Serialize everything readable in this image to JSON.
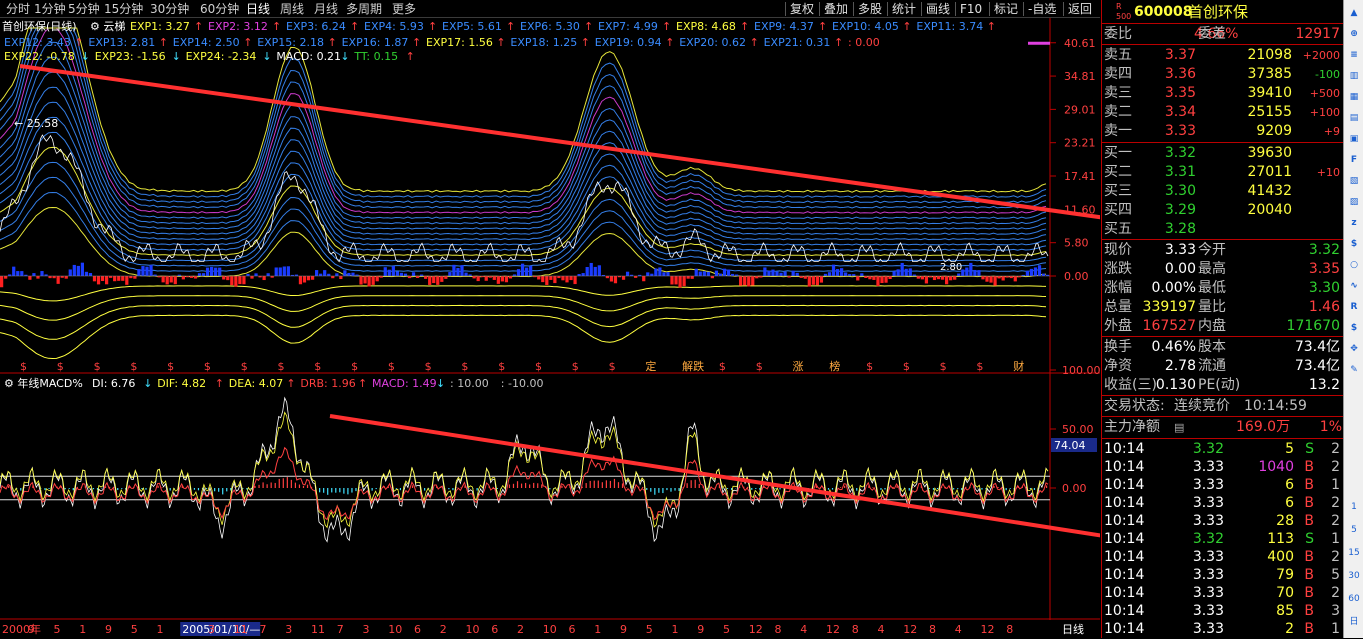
{
  "toolbar": {
    "periods": [
      "分时",
      "1分钟",
      "5分钟",
      "15分钟",
      "30分钟",
      "60分钟",
      "日线",
      "周线",
      "月线",
      "多周期",
      "更多"
    ],
    "selected": "日线",
    "right": [
      "复权",
      "叠加",
      "多股",
      "统计",
      "画线",
      "F10",
      "标记",
      "-自选",
      "返回"
    ]
  },
  "main_chart": {
    "title": "首创环保(日线)",
    "indicator_name": "云梯",
    "exp_items": [
      {
        "label": "EXP1: 3.27",
        "color": "#ffff40",
        "arrow": "↑",
        "arrow_color": "#ff4040"
      },
      {
        "label": "EXP2: 3.12",
        "color": "#e040e0",
        "arrow": "↑",
        "arrow_color": "#ff4040"
      },
      {
        "label": "EXP3: 6.24",
        "color": "#3a8cff",
        "arrow": "↑",
        "arrow_color": "#ff4040"
      },
      {
        "label": "EXP4: 5.93",
        "color": "#3a8cff",
        "arrow": "↑",
        "arrow_color": "#ff4040"
      },
      {
        "label": "EXP5: 5.61",
        "color": "#3a8cff",
        "arrow": "↑",
        "arrow_color": "#ff4040"
      },
      {
        "label": "EXP6: 5.30",
        "color": "#3a8cff",
        "arrow": "↑",
        "arrow_color": "#ff4040"
      },
      {
        "label": "EXP7: 4.99",
        "color": "#3a8cff",
        "arrow": "↑",
        "arrow_color": "#ff4040"
      },
      {
        "label": "EXP8: 4.68",
        "color": "#ffff40",
        "arrow": "↑",
        "arrow_color": "#ff4040"
      },
      {
        "label": "EXP9: 4.37",
        "color": "#3a8cff",
        "arrow": "↑",
        "arrow_color": "#ff4040"
      },
      {
        "label": "EXP10: 4.05",
        "color": "#3a8cff",
        "arrow": "↑",
        "arrow_color": "#ff4040"
      },
      {
        "label": "EXP11: 3.74",
        "color": "#3a8cff",
        "arrow": "↑",
        "arrow_color": "#ff4040"
      },
      {
        "label": "EXP12: 3.43",
        "color": "#3a8cff",
        "arrow": "↑",
        "arrow_color": "#ff4040"
      },
      {
        "label": "EXP13: 2.81",
        "color": "#3a8cff",
        "arrow": "↑",
        "arrow_color": "#ff4040"
      },
      {
        "label": "EXP14: 2.50",
        "color": "#3a8cff",
        "arrow": "↑",
        "arrow_color": "#ff4040"
      },
      {
        "label": "EXP15: 2.18",
        "color": "#3a8cff",
        "arrow": "↑",
        "arrow_color": "#ff4040"
      },
      {
        "label": "EXP16: 1.87",
        "color": "#3a8cff",
        "arrow": "↑",
        "arrow_color": "#ff4040"
      },
      {
        "label": "EXP17: 1.56",
        "color": "#ffff40",
        "arrow": "↑",
        "arrow_color": "#ff4040"
      },
      {
        "label": "EXP18: 1.25",
        "color": "#3a8cff",
        "arrow": "↑",
        "arrow_color": "#ff4040"
      },
      {
        "label": "EXP19: 0.94",
        "color": "#3a8cff",
        "arrow": "↑",
        "arrow_color": "#ff4040"
      },
      {
        "label": "EXP20: 0.62",
        "color": "#3a8cff",
        "arrow": "↑",
        "arrow_color": "#ff4040"
      },
      {
        "label": "EXP21: 0.31",
        "color": "#3a8cff",
        "arrow": "↑",
        "arrow_color": "#ff4040"
      },
      {
        "label": ": 0.00",
        "color": "#ff4040",
        "arrow": "",
        "arrow_color": "#ff4040"
      },
      {
        "label": "EXP22: -0.78",
        "color": "#ffff40",
        "arrow": "↓",
        "arrow_color": "#40e0ff"
      },
      {
        "label": "EXP23: -1.56",
        "color": "#ffff40",
        "arrow": "↓",
        "arrow_color": "#40e0ff"
      },
      {
        "label": "EXP24: -2.34",
        "color": "#ffff40",
        "arrow": "↓",
        "arrow_color": "#40e0ff"
      },
      {
        "label": "MACD: 0.21",
        "color": "#ffffff",
        "arrow": "↓",
        "arrow_color": "#40e0ff"
      },
      {
        "label": "TT: 0.15",
        "color": "#30d030",
        "arrow": "↑",
        "arrow_color": "#ff4040"
      }
    ],
    "y_ticks": [
      "40.61",
      "34.81",
      "29.01",
      "23.21",
      "17.41",
      "11.60",
      "5.80",
      "0.00"
    ],
    "peak_label": "25.58",
    "low_label": "2.80",
    "event_marks": [
      "$",
      "$",
      "$",
      "$",
      "$",
      "$",
      "$",
      "$",
      "$",
      "$",
      "$",
      "$",
      "$",
      "$",
      "$",
      "$",
      "$",
      "定",
      "解跌",
      "$",
      "$",
      "涨",
      "榜",
      "$",
      "$",
      "$",
      "$",
      "财"
    ]
  },
  "sub_chart": {
    "title": "年线MACD%",
    "items": [
      {
        "label": "DI: 6.76",
        "color": "#ffffff",
        "arrow": "↓",
        "arrow_color": "#40e0ff"
      },
      {
        "label": "DIF: 4.82",
        "color": "#ffff40",
        "arrow": "↑",
        "arrow_color": "#ff4040"
      },
      {
        "label": "DEA: 4.07",
        "color": "#ffff40",
        "arrow": "↑",
        "arrow_color": "#ff4040"
      },
      {
        "label": "DRB: 1.96",
        "color": "#ff4040",
        "arrow": "↑",
        "arrow_color": "#ff4040"
      },
      {
        "label": "MACD: 1.49",
        "color": "#e040e0",
        "arrow": "↓",
        "arrow_color": "#40e0ff"
      },
      {
        "label": ": 10.00",
        "color": "#c0c0c0",
        "arrow": "",
        "arrow_color": "#c0c0c0"
      },
      {
        "label": ": -10.00",
        "color": "#c0c0c0",
        "arrow": "",
        "arrow_color": "#c0c0c0"
      }
    ],
    "y_ticks": [
      "100.00",
      "50.00",
      "0.00"
    ],
    "current_value": "74.04"
  },
  "x_axis": {
    "labels": [
      "2000年",
      "9",
      "5",
      "1",
      "9",
      "5",
      "1",
      "2005/01/10/—",
      "3",
      "11",
      "7",
      "3",
      "11",
      "7",
      "3",
      "10",
      "6",
      "2",
      "10",
      "6",
      "2",
      "10",
      "6",
      "1",
      "9",
      "5",
      "1",
      "9",
      "5",
      "12",
      "8",
      "4",
      "12",
      "8",
      "4",
      "12",
      "8",
      "4",
      "12",
      "8"
    ],
    "period": "日线"
  },
  "quote": {
    "code": "600008",
    "name": "首创环保",
    "commission_ratio_label": "委比",
    "commission_ratio": "4.66%",
    "commission_diff_label": "委差",
    "commission_diff": "12917",
    "asks": [
      {
        "label": "卖五",
        "price": "3.37",
        "vol": "21098",
        "chg": "+2000"
      },
      {
        "label": "卖四",
        "price": "3.36",
        "vol": "37385",
        "chg": "-100"
      },
      {
        "label": "卖三",
        "price": "3.35",
        "vol": "39410",
        "chg": "+500"
      },
      {
        "label": "卖二",
        "price": "3.34",
        "vol": "25155",
        "chg": "+100"
      },
      {
        "label": "卖一",
        "price": "3.33",
        "vol": "9209",
        "chg": "+9"
      }
    ],
    "bids": [
      {
        "label": "买一",
        "price": "3.32",
        "vol": "39630",
        "chg": ""
      },
      {
        "label": "买二",
        "price": "3.31",
        "vol": "27011",
        "chg": "+10"
      },
      {
        "label": "买三",
        "price": "3.30",
        "vol": "41432",
        "chg": ""
      },
      {
        "label": "买四",
        "price": "3.29",
        "vol": "20040",
        "chg": ""
      },
      {
        "label": "买五",
        "price": "3.28",
        "vol": "",
        "chg": ""
      }
    ],
    "stats": [
      {
        "l1": "现价",
        "v1": "3.33",
        "c1": "wht",
        "l2": "今开",
        "v2": "3.32",
        "c2": "grn"
      },
      {
        "l1": "涨跌",
        "v1": "0.00",
        "c1": "wht",
        "l2": "最高",
        "v2": "3.35",
        "c2": "red"
      },
      {
        "l1": "涨幅",
        "v1": "0.00%",
        "c1": "wht",
        "l2": "最低",
        "v2": "3.30",
        "c2": "grn"
      },
      {
        "l1": "总量",
        "v1": "339197",
        "c1": "yel",
        "l2": "量比",
        "v2": "1.46",
        "c2": "red"
      },
      {
        "l1": "外盘",
        "v1": "167527",
        "c1": "red",
        "l2": "内盘",
        "v2": "171670",
        "c2": "grn"
      }
    ],
    "stats2": [
      {
        "l1": "换手",
        "v1": "0.46%",
        "l2": "股本",
        "v2": "73.4亿"
      },
      {
        "l1": "净资",
        "v1": "2.78",
        "l2": "流通",
        "v2": "73.4亿"
      },
      {
        "l1": "收益(三)",
        "v1": "0.130",
        "l2": "PE(动)",
        "v2": "13.2"
      }
    ],
    "trade_status_label": "交易状态:",
    "trade_status": "连续竞价",
    "trade_time": "10:14:59",
    "main_net_label": "主力净额",
    "main_net": "169.0万",
    "main_net_pct": "1%",
    "ticks": [
      {
        "t": "10:14",
        "p": "3.32",
        "pc": "grn",
        "v": "5",
        "vc": "yel",
        "s": "S",
        "sc": "grn",
        "n": "2"
      },
      {
        "t": "10:14",
        "p": "3.33",
        "pc": "wht",
        "v": "1040",
        "vc": "mag",
        "s": "B",
        "sc": "red",
        "n": "2"
      },
      {
        "t": "10:14",
        "p": "3.33",
        "pc": "wht",
        "v": "6",
        "vc": "yel",
        "s": "B",
        "sc": "red",
        "n": "1"
      },
      {
        "t": "10:14",
        "p": "3.33",
        "pc": "wht",
        "v": "6",
        "vc": "yel",
        "s": "B",
        "sc": "red",
        "n": "2"
      },
      {
        "t": "10:14",
        "p": "3.33",
        "pc": "wht",
        "v": "28",
        "vc": "yel",
        "s": "B",
        "sc": "red",
        "n": "2"
      },
      {
        "t": "10:14",
        "p": "3.32",
        "pc": "grn",
        "v": "113",
        "vc": "yel",
        "s": "S",
        "sc": "grn",
        "n": "1"
      },
      {
        "t": "10:14",
        "p": "3.33",
        "pc": "wht",
        "v": "400",
        "vc": "yel",
        "s": "B",
        "sc": "red",
        "n": "2"
      },
      {
        "t": "10:14",
        "p": "3.33",
        "pc": "wht",
        "v": "79",
        "vc": "yel",
        "s": "B",
        "sc": "red",
        "n": "5"
      },
      {
        "t": "10:14",
        "p": "3.33",
        "pc": "wht",
        "v": "70",
        "vc": "yel",
        "s": "B",
        "sc": "red",
        "n": "2"
      },
      {
        "t": "10:14",
        "p": "3.33",
        "pc": "wht",
        "v": "85",
        "vc": "yel",
        "s": "B",
        "sc": "red",
        "n": "3"
      },
      {
        "t": "10:14",
        "p": "3.33",
        "pc": "wht",
        "v": "2",
        "vc": "yel",
        "s": "B",
        "sc": "red",
        "n": "1"
      }
    ]
  },
  "right_bar": {
    "icons": [
      "arrow-up-icon",
      "zoom-icon",
      "list-icon",
      "bar-chart-icon",
      "table-icon",
      "grid-icon",
      "monitor-icon",
      "f10-icon",
      "calendar-icon",
      "calendar-dot-icon",
      "fiz-icon",
      "fund-icon",
      "circle-icon",
      "chart-icon",
      "rsi-icon",
      "dollar-icon",
      "move-icon",
      "pen-icon"
    ],
    "labels": [
      "Fiz",
      "RSI",
      "1",
      "5",
      "15",
      "30",
      "60",
      "日"
    ]
  },
  "colors": {
    "up": "#ff4040",
    "down": "#30d030",
    "ema": "#3a8cff",
    "border": "#b00000"
  }
}
